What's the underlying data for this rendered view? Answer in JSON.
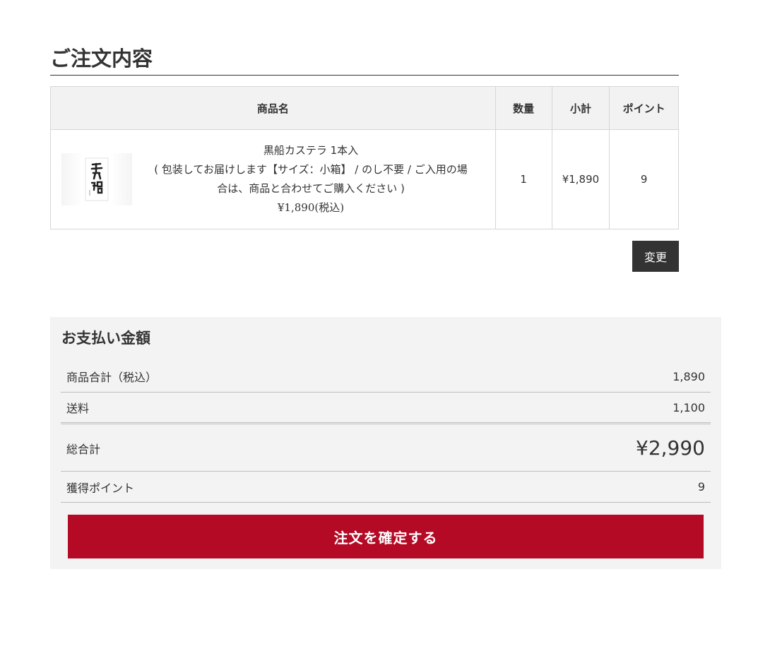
{
  "order": {
    "title": "ご注文内容",
    "columns": {
      "name": "商品名",
      "quantity": "数量",
      "subtotal": "小計",
      "points": "ポイント"
    },
    "items": [
      {
        "name": "黒船カステラ 1本入",
        "options": "( 包装してお届けします【サイズ：小箱】 / のし不要 / ご入用の場合は、商品と合わせてご購入ください )",
        "price": "¥1,890(税込)",
        "quantity": "1",
        "subtotal": "¥1,890",
        "points": "9"
      }
    ],
    "change_button": "変更"
  },
  "payment": {
    "title": "お支払い金額",
    "rows": [
      {
        "label": "商品合計（税込）",
        "value": "1,890"
      },
      {
        "label": "送料",
        "value": "1,100"
      },
      {
        "label": "総合計",
        "value": "¥2,990"
      },
      {
        "label": "獲得ポイント",
        "value": "9"
      }
    ],
    "confirm_button": "注文を確定する"
  },
  "colors": {
    "accent": "#b40a25",
    "dark_button": "#333333",
    "panel_bg": "#f3f3f3"
  }
}
